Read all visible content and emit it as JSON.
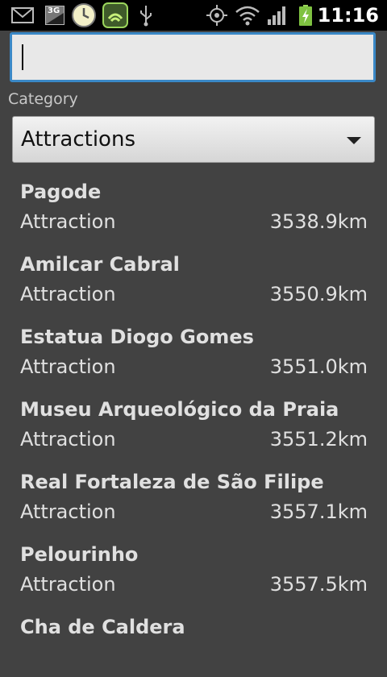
{
  "status_bar": {
    "time": "11:16",
    "icons": [
      "gmail-icon",
      "3g-icon",
      "clock-icon",
      "shield-app-icon",
      "usb-icon",
      "gps-icon",
      "wifi-icon",
      "signal-icon",
      "battery-charging-icon"
    ],
    "badge_3g": "3G"
  },
  "search": {
    "value": "",
    "placeholder": ""
  },
  "category": {
    "label": "Category",
    "selected": "Attractions"
  },
  "places": [
    {
      "name": "Pagode",
      "type": "Attraction",
      "distance": "3538.9km"
    },
    {
      "name": "Amilcar Cabral",
      "type": "Attraction",
      "distance": "3550.9km"
    },
    {
      "name": "Estatua Diogo Gomes",
      "type": "Attraction",
      "distance": "3551.0km"
    },
    {
      "name": "Museu Arqueológico da Praia",
      "type": "Attraction",
      "distance": "3551.2km"
    },
    {
      "name": "Real Fortaleza de São Filipe",
      "type": "Attraction",
      "distance": "3557.1km"
    },
    {
      "name": "Pelourinho",
      "type": "Attraction",
      "distance": "3557.5km"
    },
    {
      "name": "Cha de Caldera",
      "type": "",
      "distance": ""
    }
  ],
  "colors": {
    "accent": "#3a88c6",
    "background": "#424242",
    "statusbar": "#000000"
  }
}
